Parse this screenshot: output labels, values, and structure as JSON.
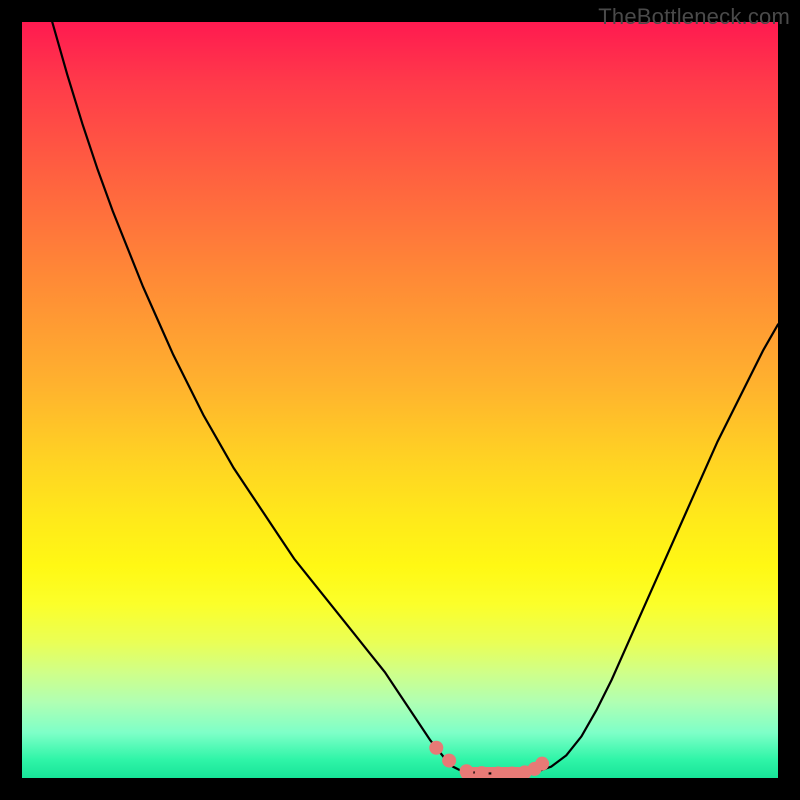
{
  "watermark": "TheBottleneck.com",
  "colors": {
    "background": "#000000",
    "gradient_top": "#ff1a50",
    "gradient_bottom": "#17e498",
    "line": "#000000",
    "marker": "#e77a76"
  },
  "chart_data": {
    "type": "line",
    "title": "",
    "xlabel": "",
    "ylabel": "",
    "xlim": [
      0,
      100
    ],
    "ylim": [
      0,
      100
    ],
    "grid": false,
    "legend": false,
    "x": [
      4,
      6,
      8,
      10,
      12,
      14,
      16,
      18,
      20,
      22,
      24,
      26,
      28,
      30,
      32,
      34,
      36,
      38,
      40,
      42,
      44,
      46,
      48,
      50,
      52,
      54,
      56,
      57,
      58,
      60,
      61,
      62,
      64,
      66,
      68,
      70,
      72,
      74,
      76,
      78,
      80,
      82,
      84,
      86,
      88,
      90,
      92,
      94,
      96,
      98,
      100
    ],
    "y": [
      100,
      93,
      86.5,
      80.5,
      75,
      70,
      65,
      60.5,
      56,
      52,
      48,
      44.5,
      41,
      38,
      35,
      32,
      29,
      26.5,
      24,
      21.5,
      19,
      16.5,
      14,
      11,
      8,
      5,
      2.5,
      1.5,
      1,
      0.7,
      0.6,
      0.6,
      0.6,
      0.6,
      0.8,
      1.5,
      3,
      5.5,
      9,
      13,
      17.5,
      22,
      26.5,
      31,
      35.5,
      40,
      44.5,
      48.5,
      52.5,
      56.5,
      60
    ],
    "markers": {
      "x": [
        54.8,
        56.5,
        58.8,
        60.8,
        63.0,
        64.8,
        66.5,
        67.8,
        68.8
      ],
      "y": [
        4.0,
        2.3,
        0.9,
        0.65,
        0.6,
        0.6,
        0.75,
        1.2,
        1.9
      ]
    },
    "flat_segment_band": {
      "x_start": 58.0,
      "x_end": 66.5,
      "half_width": 0.85
    },
    "notes": "V-shaped bottleneck curve over a rainbow gradient; left branch starts near top-left at y=100 and descends to a flat minimum near y≈0.6 around x≈60-66, then rises to ~y=60 at right edge. Pink markers cluster around the trough."
  }
}
